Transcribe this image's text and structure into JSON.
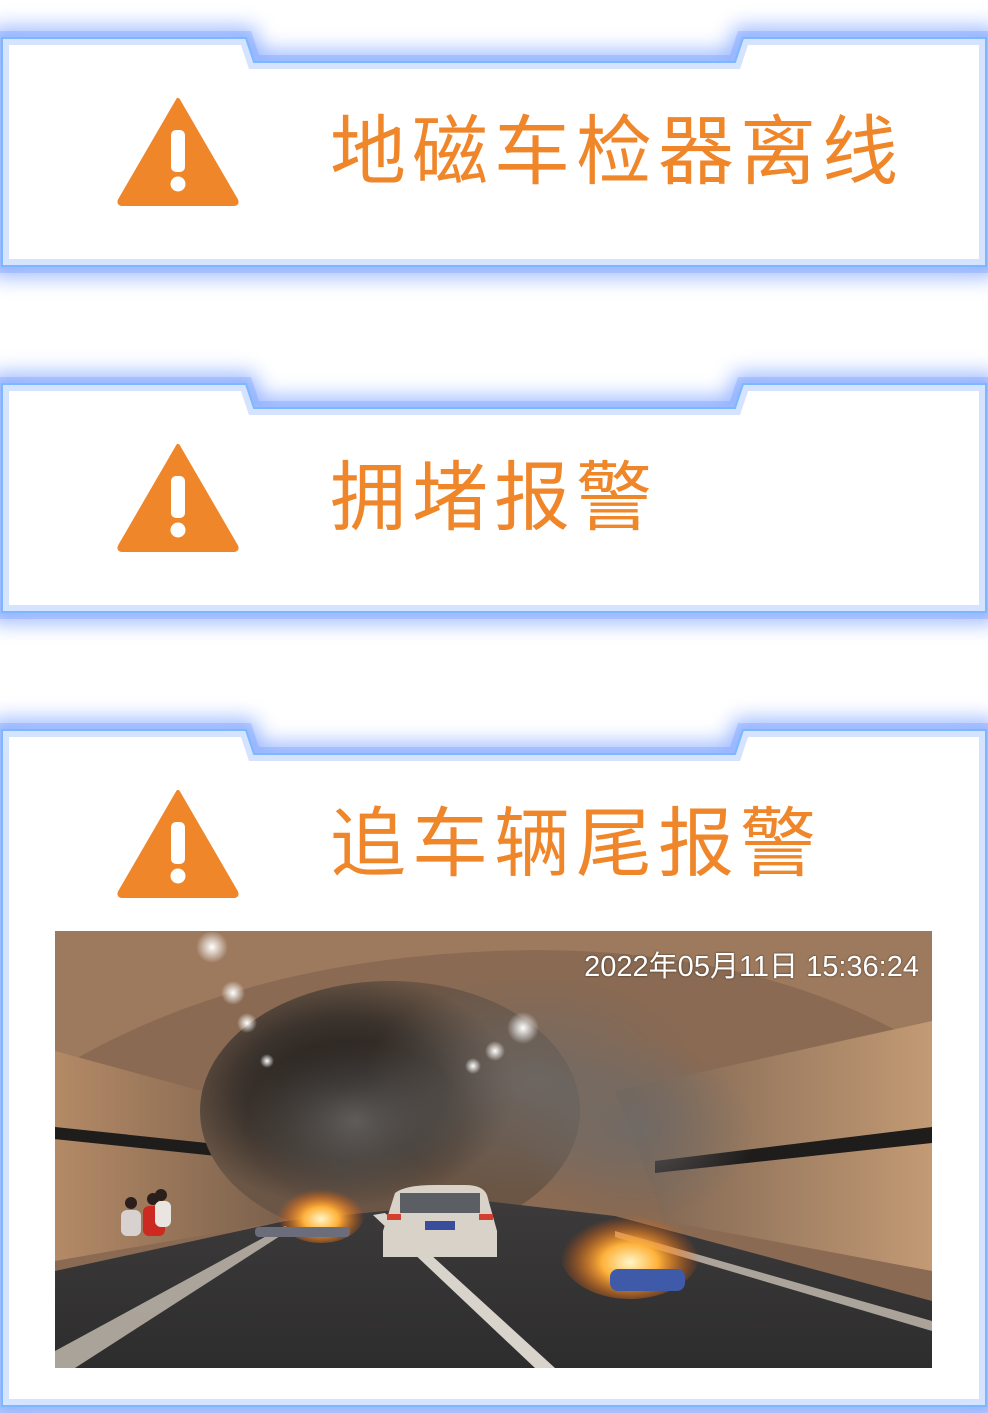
{
  "alerts": [
    {
      "label": "地磁车检器离线",
      "icon": "warning-triangle-icon"
    },
    {
      "label": "拥堵报警",
      "icon": "warning-triangle-icon"
    },
    {
      "label": "追车辆尾报警",
      "icon": "warning-triangle-icon"
    }
  ],
  "camera": {
    "timestamp": "2022年05月11日 15:36:24"
  },
  "colors": {
    "accent": "#f0862a",
    "frame_glow": "#3f7cff",
    "frame_border": "#7fc7ff"
  }
}
